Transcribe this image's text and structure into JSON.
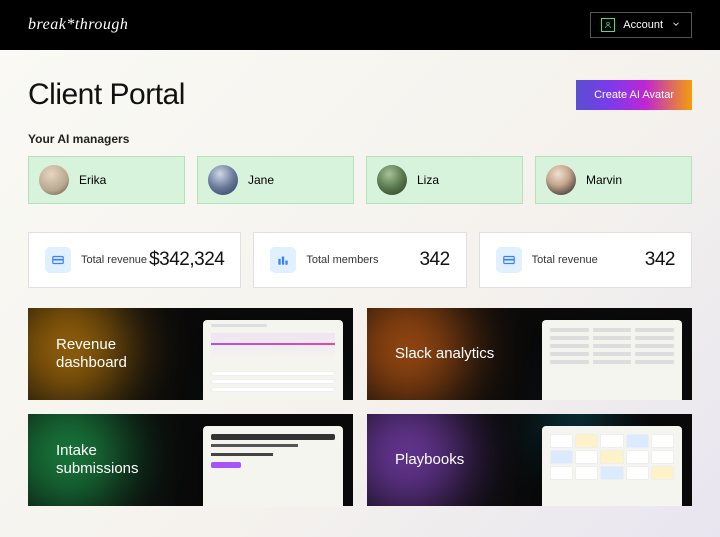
{
  "header": {
    "logo": "break*through",
    "account_label": "Account"
  },
  "page": {
    "title": "Client Portal",
    "create_button": "Create AI Avatar",
    "managers_label": "Your AI managers"
  },
  "managers": [
    {
      "name": "Erika"
    },
    {
      "name": "Jane"
    },
    {
      "name": "Liza"
    },
    {
      "name": "Marvin"
    }
  ],
  "stats": [
    {
      "icon": "card",
      "label": "Total revenue",
      "value": "$342,324"
    },
    {
      "icon": "bars",
      "label": "Total members",
      "value": "342"
    },
    {
      "icon": "card",
      "label": "Total revenue",
      "value": "342"
    }
  ],
  "panels": [
    {
      "title": "Revenue dashboard"
    },
    {
      "title": "Slack analytics"
    },
    {
      "title": "Intake submissions"
    },
    {
      "title": "Playbooks"
    }
  ]
}
